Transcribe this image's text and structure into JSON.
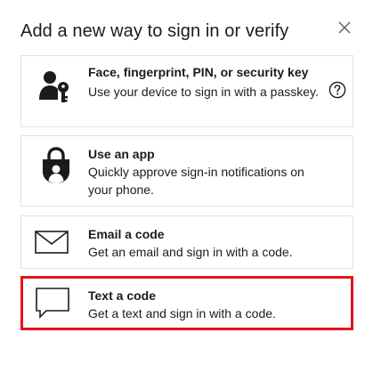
{
  "dialog": {
    "title": "Add a new way to sign in or verify",
    "close_icon": "close-icon"
  },
  "options": [
    {
      "title": "Face, fingerprint, PIN, or security key",
      "description": "Use your device to sign in with a passkey.",
      "icon": "person-key-icon",
      "help_icon": "help-circle-icon"
    },
    {
      "title": "Use an app",
      "description": "Quickly approve sign-in notifications on your phone.",
      "icon": "authenticator-lock-icon"
    },
    {
      "title": "Email a code",
      "description": "Get an email and sign in with a code.",
      "icon": "envelope-icon"
    },
    {
      "title": "Text a code",
      "description": "Get a text and sign in with a code.",
      "icon": "chat-bubble-icon",
      "selected": true,
      "highlight_color": "#e1141b"
    }
  ]
}
